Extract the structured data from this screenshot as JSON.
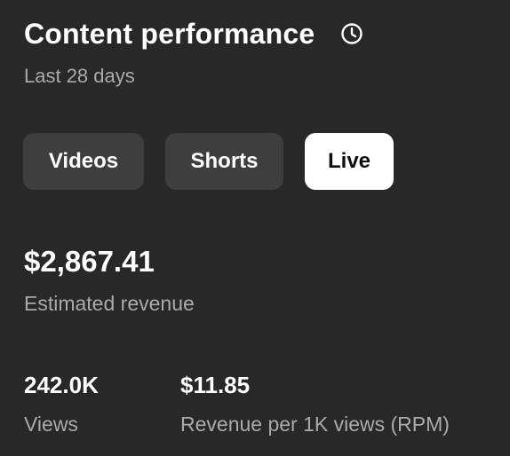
{
  "header": {
    "title": "Content performance",
    "icon": "clock-icon",
    "subtitle": "Last 28 days"
  },
  "tabs": [
    {
      "label": "Videos",
      "selected": false
    },
    {
      "label": "Shorts",
      "selected": false
    },
    {
      "label": "Live",
      "selected": true
    }
  ],
  "revenue": {
    "value": "$2,867.41",
    "label": "Estimated revenue"
  },
  "metrics": {
    "views": {
      "value": "242.0K",
      "label": "Views"
    },
    "rpm": {
      "value": "$11.85",
      "label": "Revenue per 1K views (RPM)"
    }
  },
  "colors": {
    "background": "#282828",
    "chip": "#3e3e3e",
    "chip_active": "#ffffff",
    "secondary_text": "#aaaaaa"
  }
}
